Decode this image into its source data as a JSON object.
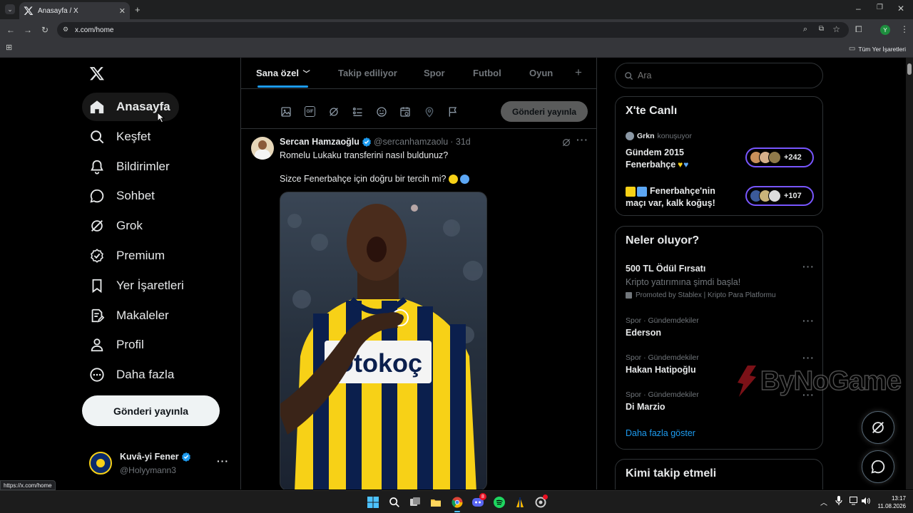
{
  "browser": {
    "tab_title": "Anasayfa / X",
    "url": "x.com/home",
    "bookmarks_label": "Tüm Yer İşaretleri",
    "profile_initial": "Y",
    "status_url": "https://x.com/home"
  },
  "nav": {
    "items": [
      {
        "label": "Anasayfa",
        "icon": "home-icon"
      },
      {
        "label": "Keşfet",
        "icon": "search-icon"
      },
      {
        "label": "Bildirimler",
        "icon": "bell-icon"
      },
      {
        "label": "Sohbet",
        "icon": "chat-icon"
      },
      {
        "label": "Grok",
        "icon": "grok-icon"
      },
      {
        "label": "Premium",
        "icon": "verified-icon"
      },
      {
        "label": "Yer İşaretleri",
        "icon": "bookmark-icon"
      },
      {
        "label": "Makaleler",
        "icon": "articles-icon"
      },
      {
        "label": "Profil",
        "icon": "person-icon"
      },
      {
        "label": "Daha fazla",
        "icon": "more-circle-icon"
      }
    ],
    "post_button": "Gönderi yayınla",
    "account": {
      "name": "Kuvâ-yi Fener",
      "handle": "@Holyymann3"
    }
  },
  "feed": {
    "tabs": [
      "Sana özel",
      "Takip ediliyor",
      "Spor",
      "Futbol",
      "Oyun"
    ],
    "composer_button": "Gönderi yayınla",
    "tweet": {
      "author": "Sercan Hamzaoğlu",
      "handle": "@sercanhamzaolu",
      "time": "· 31d",
      "line1": "Romelu Lukaku transferini nasıl buldunuz?",
      "line2": "Sizce Fenerbahçe için doğru bir tercih mi?",
      "image_text": "Otokoç"
    }
  },
  "sidebar": {
    "search_placeholder": "Ara",
    "live": {
      "title": "X'te Canlı",
      "speaker": "Grkn",
      "speaker_status": "konuşuyor",
      "spaces": [
        {
          "line1": "Gündem 2015",
          "line2": "Fenerbahçe",
          "count": "+242"
        },
        {
          "line1": "Fenerbahçe'nin",
          "line2": "maçı var, kalk koğuş!",
          "count": "+107"
        }
      ]
    },
    "trends": {
      "title": "Neler oluyor?",
      "promo": {
        "title": "500 TL Ödül Fırsatı",
        "subtitle": "Kripto yatırımına şimdi başla!",
        "promoted": "Promoted by Stablex | Kripto Para Platformu"
      },
      "items": [
        {
          "meta": "Spor · Gündemdekiler",
          "name": "Ederson"
        },
        {
          "meta": "Spor · Gündemdekiler",
          "name": "Hakan Hatipoğlu"
        },
        {
          "meta": "Spor · Gündemdekiler",
          "name": "Di Marzio"
        }
      ],
      "show_more": "Daha fazla göster"
    },
    "who_to_follow": "Kimi takip etmeli"
  },
  "watermark": "ByNoGame",
  "taskbar": {
    "time": "13:17",
    "date": "11.08.2026",
    "discord_badge": "8"
  },
  "colors": {
    "accent": "#1d9bf0",
    "live_border": "#7856ff",
    "verified": "#1d9bf0",
    "background": "#000000"
  }
}
